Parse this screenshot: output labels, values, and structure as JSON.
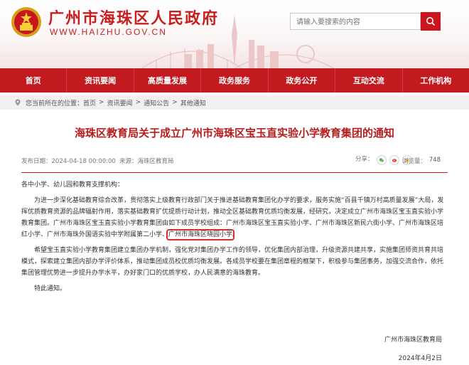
{
  "header": {
    "site_title": "广州市海珠区人民政府",
    "site_domain": "WWW.HAIZHU.GOV.CN",
    "search_placeholder": "请输入要搜索的内容",
    "accent_color": "#c21a1f"
  },
  "nav": {
    "items": [
      "首页",
      "资讯要闻",
      "高质量发展",
      "政务服务",
      "政务公开",
      "互动交流",
      "工作机构"
    ]
  },
  "breadcrumb": {
    "prefix": "您当前所在的位置：",
    "items": [
      "首页",
      "资讯要闻",
      "通知公告",
      "其他通知"
    ],
    "separator": ">"
  },
  "article": {
    "title": "海珠区教育局关于成立广州市海珠区宝玉直实验小学教育集团的通知",
    "date": "发布日期：2024-04-18 00:00:00",
    "source": "来源：海珠区教育局",
    "share_label": "分享：",
    "views_label": "浏览量：",
    "views": "748",
    "greeting": "各中小学、幼儿园和教育支撑机构：",
    "para1_before": "为进一步深化基础教育综合改革，贯彻落实上级教育行政部门关于推进基础教育集团化办学的要求，服务实施“百县千镇万村高质量发展”大局，发挥优质教育资源的品牌辐射作用，落实基础教育扩优提质行动计划，推动全区基础教育优质均衡发展，经研究，决定成立广州市海珠区宝玉直实验小学教育集团。广州市海珠区宝玉直实验小学教育集团由如下成员学校组成：广州市海珠区宝玉直实验小学、广州市海珠区新民六街小学、广州市海珠区培红小学、广州市海珠外国语实验中学附属第二小学、",
    "para1_highlight": "广州市海珠区晓园小学",
    "para1_after": "。",
    "para2": "希望宝玉直实验小学教育集团建立集团办学机制，强化党对集团办学工作的领导，优化集团内部治理，升级资源共建共享，实施集团师资共育共培模式，探索建立集团内部办学评价体系，推动集团成员校优质均衡发展。各成员学校要在集团章程的框架下，积极参与集团事务，加强交流合作，依托集团管理优势进一步提升办学水平，办好家门口的优质学校，办人民满意的海珠教育。",
    "closing": "特此通知。",
    "signature_org": "广州市海珠区教育局",
    "signature_date": "2024年4月2日"
  }
}
